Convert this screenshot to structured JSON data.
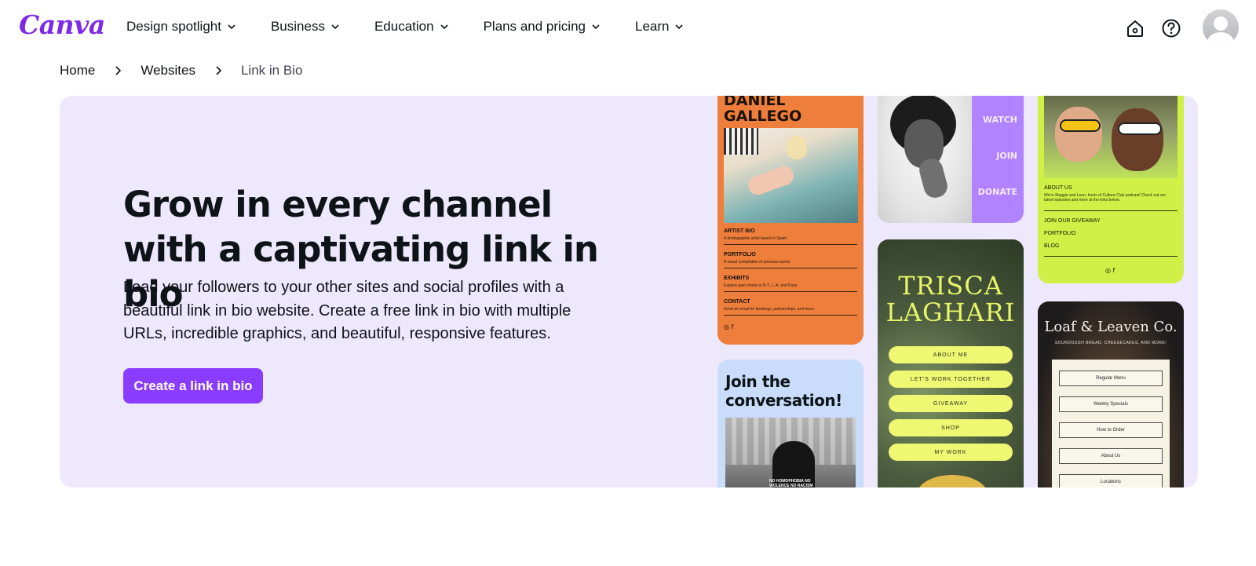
{
  "nav": {
    "logo": "Canva",
    "menu": [
      {
        "label": "Design spotlight"
      },
      {
        "label": "Business"
      },
      {
        "label": "Education"
      },
      {
        "label": "Plans and pricing"
      },
      {
        "label": "Learn"
      }
    ],
    "icons": [
      "home-icon",
      "help-icon",
      "avatar"
    ]
  },
  "breadcrumb": {
    "items": [
      "Home",
      "Websites"
    ],
    "current": "Link in Bio"
  },
  "hero": {
    "title": "Grow in every channel with a captivating link in bio",
    "description": "Lead your followers to your other sites and social profiles with a beautiful link in bio website. Create a free link in bio with multiple URLs, incredible graphics, and beautiful, responsive features.",
    "cta_label": "Create a link in bio",
    "background_color": "#ede8fb",
    "cta_color": "#8b3dff"
  },
  "templates": {
    "daniel": {
      "name_line1": "DANIEL",
      "name_line2": "GALLEGO",
      "sections": [
        {
          "heading": "ARTIST BIO",
          "text": "A photographic artist based in Spain."
        },
        {
          "heading": "PORTFOLIO",
          "text": "A visual compilation of previous works."
        },
        {
          "heading": "EXHIBITS",
          "text": "Explore past shows in N.Y., L.A. and Paris."
        },
        {
          "heading": "CONTACT",
          "text": "Send an email for bookings, partnerships, and more."
        }
      ],
      "social": "◎  f"
    },
    "watch": {
      "links": [
        "WATCH",
        "JOIN",
        "DONATE"
      ]
    },
    "culture": {
      "about_heading": "ABOUT US",
      "about_text": "We're Maggie and Leon, hosts of Culture Club podcast! Check out our latest episodes and more at the links below.",
      "links": [
        "JOIN OUR GIVEAWAY",
        "PORTFOLIO",
        "BLOG"
      ],
      "social": "◎  f"
    },
    "trisca": {
      "name_line1": "TRISCA",
      "name_line2": "LAGHARI",
      "links": [
        "ABOUT ME",
        "LET'S WORK TOGETHER",
        "GIVEAWAY",
        "SHOP",
        "MY WORK"
      ]
    },
    "join": {
      "title_line1": "Join the",
      "title_line2": "conversation!",
      "shirt": "NO HOMOPHOBIA NO VIOLENCE NO RACISM"
    },
    "loaf": {
      "name": "Loaf & Leaven Co.",
      "tagline": "SOURDOUGH BREAD, CHEESECAKES, AND MORE!",
      "links": [
        "Regular Menu",
        "Weekly Specials",
        "How to Order",
        "About Us",
        "Locations"
      ]
    }
  }
}
